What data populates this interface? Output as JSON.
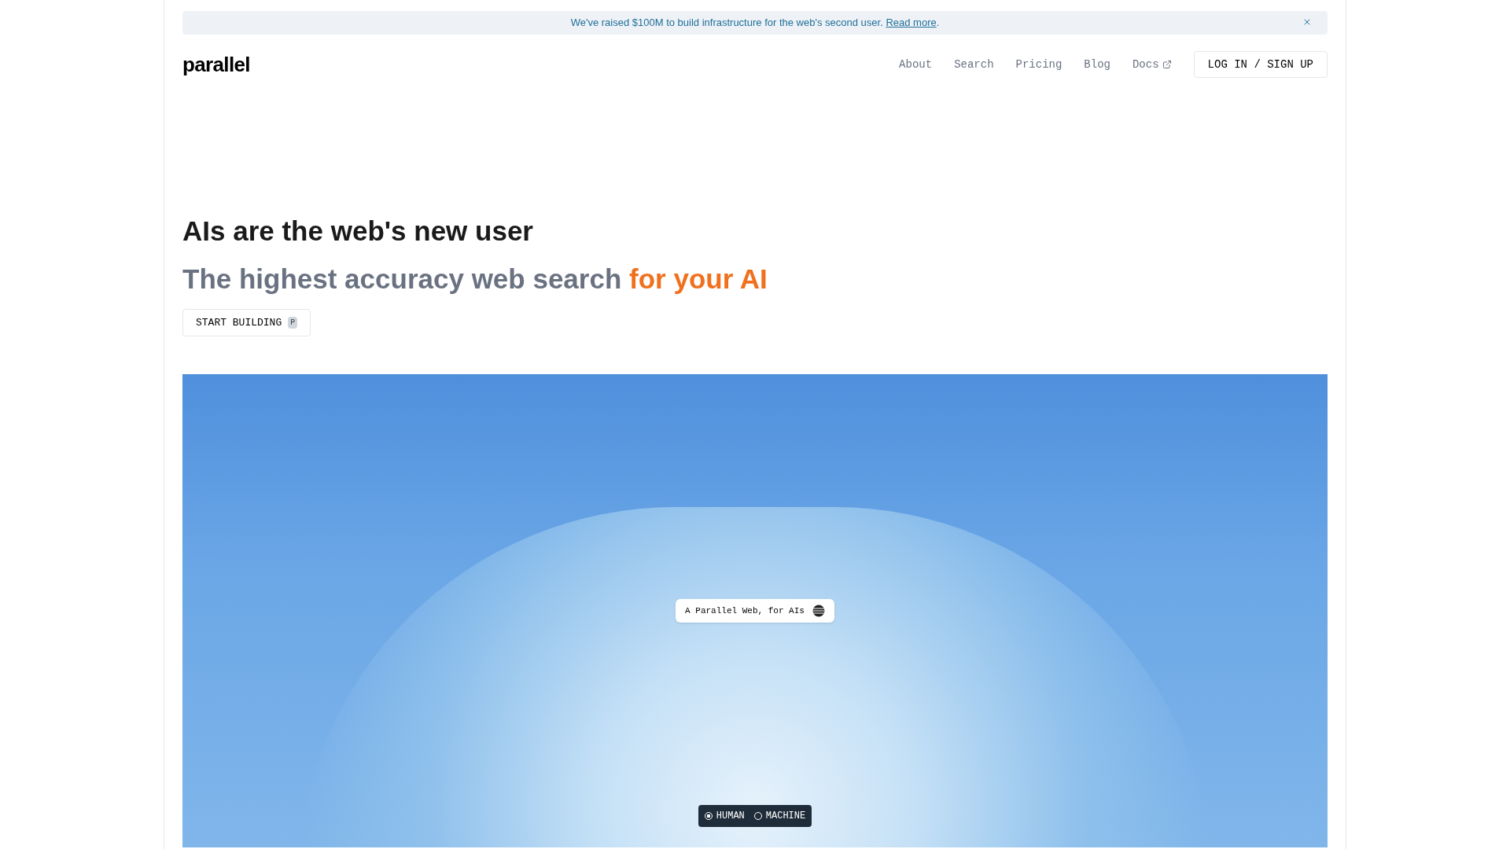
{
  "banner": {
    "text": "We've raised $100M to build infrastructure for the web's second user.",
    "link": "Read more",
    "after": "."
  },
  "logo": "parallel",
  "nav": [
    {
      "label": "About",
      "kind": "internal"
    },
    {
      "label": "Search",
      "kind": "internal"
    },
    {
      "label": "Pricing",
      "kind": "internal"
    },
    {
      "label": "Blog",
      "kind": "internal"
    },
    {
      "label": "Docs",
      "kind": "external"
    }
  ],
  "auth_button": "LOG IN / SIGN UP",
  "hero": {
    "heading": "AIs are the web's new user",
    "subtitle": "The highest accuracy web search",
    "subtitle_accent": "for your AI",
    "cta": "START BUILDING",
    "cta_key": "P"
  },
  "visual": {
    "chip": "A Parallel Web, for AIs",
    "modes": [
      {
        "label": "HUMAN",
        "selected": true
      },
      {
        "label": "MACHINE",
        "selected": false
      }
    ]
  }
}
